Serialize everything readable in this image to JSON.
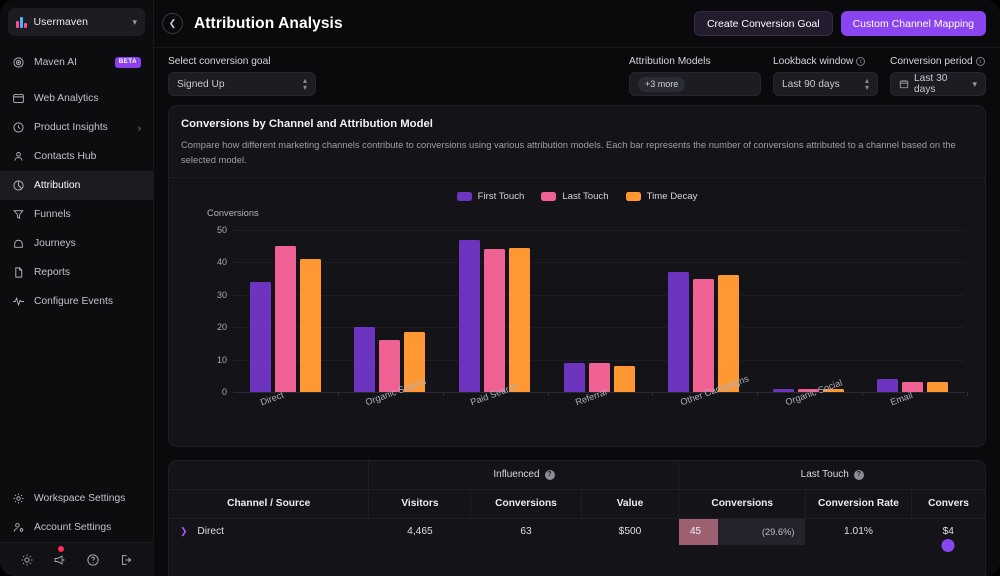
{
  "sidebar": {
    "workspace": {
      "name": "Usermaven",
      "icon": "chevron-down-icon"
    },
    "items": [
      {
        "label": "Maven AI",
        "icon": "sparkle-ai-icon",
        "badge": "BETA",
        "active": false
      },
      {
        "label": "Web Analytics",
        "icon": "window-icon",
        "active": false
      },
      {
        "label": "Product Insights",
        "icon": "clock-icon",
        "arrow": "›",
        "active": false
      },
      {
        "label": "Contacts Hub",
        "icon": "person-icon",
        "active": false
      },
      {
        "label": "Attribution",
        "icon": "pie-chart-icon",
        "active": true
      },
      {
        "label": "Funnels",
        "icon": "funnel-icon",
        "active": false
      },
      {
        "label": "Journeys",
        "icon": "journey-icon",
        "active": false
      },
      {
        "label": "Reports",
        "icon": "document-icon",
        "active": false
      },
      {
        "label": "Configure Events",
        "icon": "pulse-icon",
        "active": false
      }
    ],
    "footer_items": [
      {
        "label": "Workspace Settings",
        "icon": "gear-icon"
      },
      {
        "label": "Account Settings",
        "icon": "user-gear-icon"
      }
    ],
    "bottom_icons": [
      {
        "name": "theme-sun-icon",
        "badge": false
      },
      {
        "name": "megaphone-icon",
        "badge": true
      },
      {
        "name": "help-circle-icon",
        "badge": false
      },
      {
        "name": "logout-icon",
        "badge": false
      }
    ]
  },
  "header": {
    "collapse_icon": "chevron-left-icon",
    "title": "Attribution Analysis",
    "create_goal_label": "Create Conversion Goal",
    "custom_mapping_label": "Custom Channel Mapping"
  },
  "filters": {
    "goal": {
      "label": "Select conversion goal",
      "value": "Signed Up"
    },
    "models": {
      "label": "Attribution Models",
      "value": "+3 more"
    },
    "lookback": {
      "label": "Lookback window",
      "value": "Last 90 days"
    },
    "conversion_period": {
      "label": "Conversion period",
      "value": "Last 30 days",
      "icon": "calendar-icon"
    }
  },
  "chart_card": {
    "title": "Conversions by Channel and Attribution Model",
    "description": "Compare how different marketing channels contribute to conversions using various attribution models. Each bar represents the number of conversions attributed to a channel based on the selected model."
  },
  "chart_data": {
    "type": "bar",
    "title": "Conversions by Channel and Attribution Model",
    "xlabel": "",
    "ylabel": "Conversions",
    "ylim": [
      0,
      50
    ],
    "yticks": [
      0,
      10,
      20,
      30,
      40,
      50
    ],
    "grid": true,
    "legend_position": "top-center",
    "categories": [
      "Direct",
      "Organic Search",
      "Paid Search",
      "Referral",
      "Other Campaigns",
      "Organic Social",
      "Email"
    ],
    "series": [
      {
        "name": "First Touch",
        "color": "#6d34c0",
        "values": [
          34,
          20,
          47,
          9,
          37,
          1,
          4
        ]
      },
      {
        "name": "Last Touch",
        "color": "#ee6192",
        "values": [
          45,
          16,
          44,
          9,
          35,
          1,
          3
        ]
      },
      {
        "name": "Time Decay",
        "color": "#ff9733",
        "values": [
          41,
          18.5,
          44.5,
          8,
          36,
          1,
          3
        ]
      }
    ]
  },
  "table": {
    "group_headers": [
      {
        "label": "",
        "span": 1
      },
      {
        "label": "Influenced",
        "span": 3,
        "icon": "question-icon"
      },
      {
        "label": "Last Touch",
        "span": 3,
        "icon": "question-icon"
      }
    ],
    "columns": [
      "Channel / Source",
      "Visitors",
      "Conversions",
      "Value",
      "Conversions",
      "Conversion Rate",
      "Convers"
    ],
    "rows": [
      {
        "expand_icon": "chevron-right-icon",
        "channel": "Direct",
        "visitors": "4,465",
        "influenced_conversions": "63",
        "value": "$500",
        "last_touch_conversions": "45",
        "last_touch_pct": "(29.6%)",
        "last_touch_bar_pct": 31,
        "conversion_rate": "1.01%",
        "last_value": "$4"
      }
    ]
  }
}
